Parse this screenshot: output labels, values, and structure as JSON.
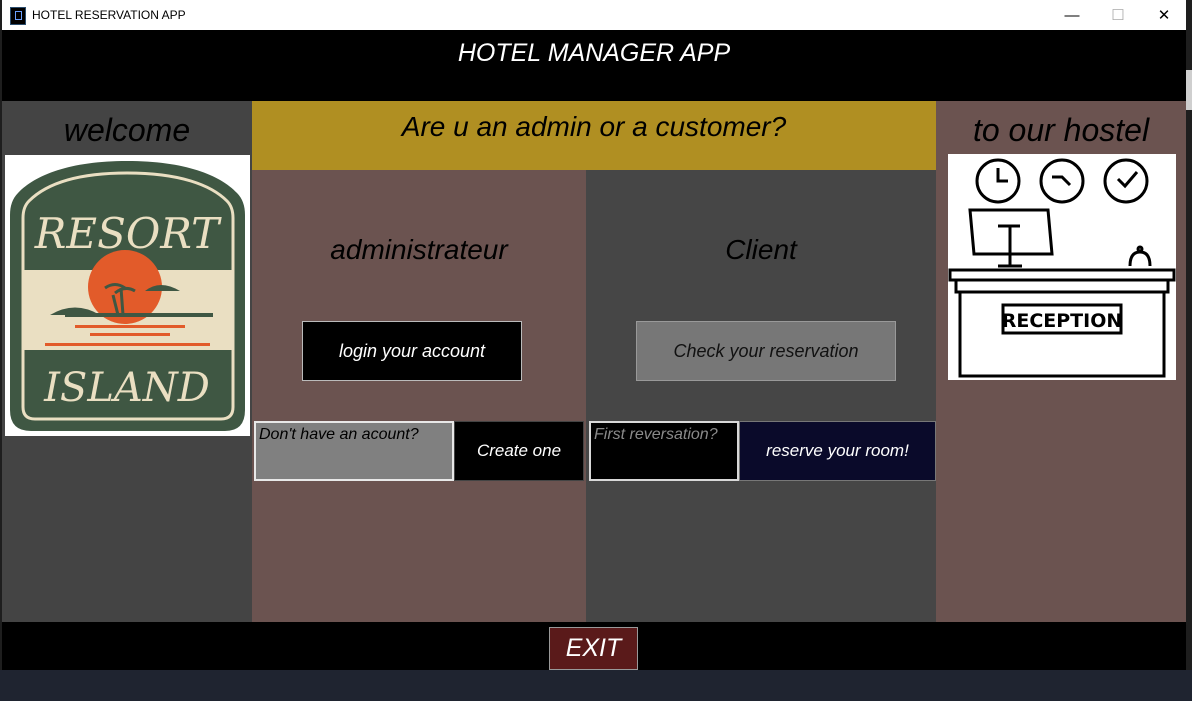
{
  "window": {
    "title": "HOTEL RESERVATION APP",
    "minimize": "—",
    "maximize": "☐",
    "close": "✕"
  },
  "header": {
    "title": "HOTEL MANAGER APP"
  },
  "left": {
    "title": "welcome",
    "logo": {
      "line1": "RESORT",
      "line2": "ISLAND"
    }
  },
  "right": {
    "title": "to our hostel",
    "sign": "RECEPTION"
  },
  "question": "Are u an admin or a customer?",
  "admin": {
    "title": "administrateur",
    "login_label": "login your account",
    "no_account_label": "Don't have an acount?",
    "create_label": "Create one"
  },
  "client": {
    "title": "Client",
    "check_label": "Check your reservation",
    "first_label": "First reversation?",
    "reserve_label": "reserve your room!"
  },
  "footer": {
    "exit_label": "EXIT"
  },
  "colors": {
    "header": "#000000",
    "side_gray": "#444444",
    "brown": "#6b5350",
    "gold": "#b08f22",
    "exit": "#5a1a1a",
    "logo_green": "#3f5743",
    "logo_orange": "#e25b2a",
    "logo_cream": "#eadfc2"
  }
}
